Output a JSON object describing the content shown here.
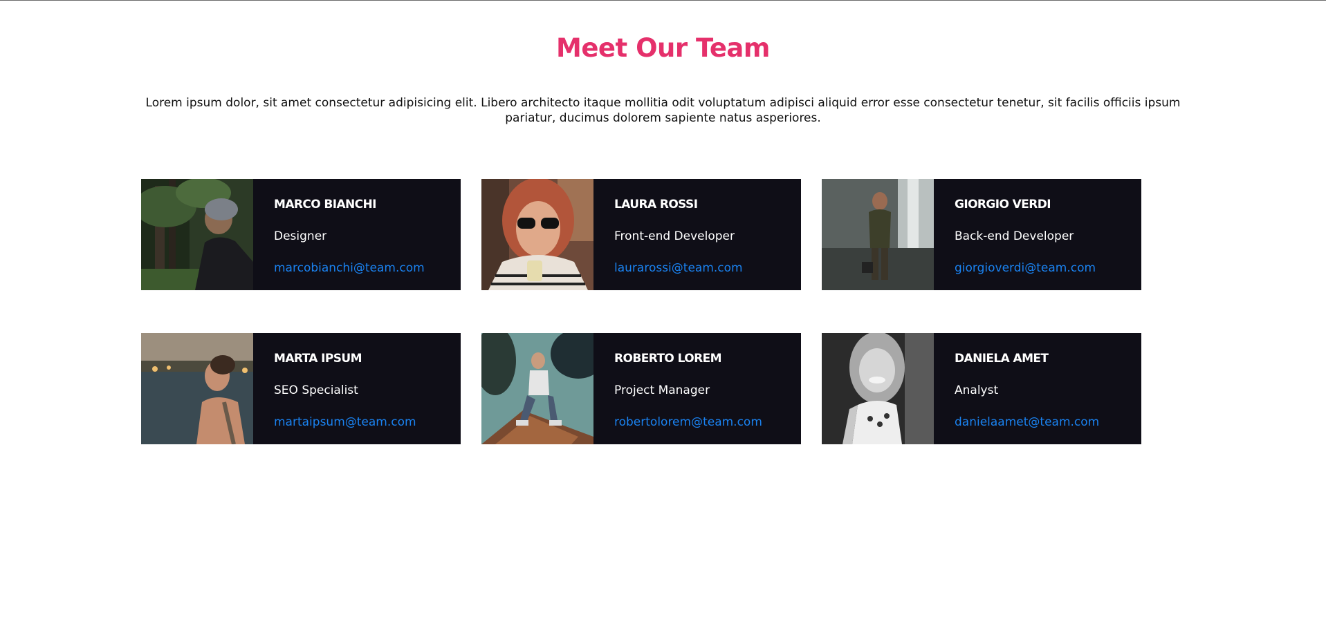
{
  "page": {
    "title": "Meet Our Team",
    "intro": "Lorem ipsum dolor, sit amet consectetur adipisicing elit. Libero architecto itaque mollitia odit voluptatum adipisci aliquid error esse consectetur tenetur, sit facilis officiis ipsum pariatur, ducimus dolorem sapiente natus asperiores."
  },
  "colors": {
    "accent": "#e5306b",
    "card_bg": "#0f0e17",
    "link": "#1a82f0"
  },
  "team": [
    {
      "name": "MARCO BIANCHI",
      "role": "Designer",
      "email": "marcobianchi@team.com"
    },
    {
      "name": "LAURA ROSSI",
      "role": "Front-end Developer",
      "email": "laurarossi@team.com"
    },
    {
      "name": "GIORGIO VERDI",
      "role": "Back-end Developer",
      "email": "giorgioverdi@team.com"
    },
    {
      "name": "MARTA IPSUM",
      "role": "SEO Specialist",
      "email": "martaipsum@team.com"
    },
    {
      "name": "ROBERTO LOREM",
      "role": "Project Manager",
      "email": "robertolorem@team.com"
    },
    {
      "name": "DANIELA AMET",
      "role": "Analyst",
      "email": "danielaamet@team.com"
    }
  ]
}
